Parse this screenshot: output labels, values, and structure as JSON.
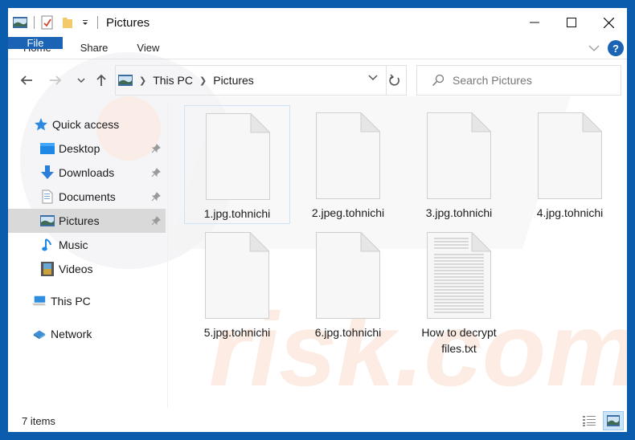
{
  "window": {
    "title": "Pictures",
    "controls": [
      "minimize",
      "maximize",
      "close"
    ]
  },
  "ribbon": {
    "tabs": [
      {
        "label": "File",
        "active": true
      },
      {
        "label": "Home"
      },
      {
        "label": "Share"
      },
      {
        "label": "View"
      }
    ],
    "help_label": "?"
  },
  "navigation": {
    "back": "back-arrow",
    "forward": "forward-arrow",
    "recent": "chevron-down",
    "up": "up-arrow",
    "breadcrumb": [
      "This PC",
      "Pictures"
    ],
    "search_placeholder": "Search Pictures"
  },
  "sidebar": {
    "items": [
      {
        "label": "Quick access",
        "icon": "star-icon",
        "pinned": false
      },
      {
        "label": "Desktop",
        "icon": "desktop-icon",
        "pinned": true
      },
      {
        "label": "Downloads",
        "icon": "download-icon",
        "pinned": true
      },
      {
        "label": "Documents",
        "icon": "documents-icon",
        "pinned": true
      },
      {
        "label": "Pictures",
        "icon": "pictures-icon",
        "pinned": true,
        "selected": true
      },
      {
        "label": "Music",
        "icon": "music-icon",
        "pinned": false
      },
      {
        "label": "Videos",
        "icon": "videos-icon",
        "pinned": false
      },
      {
        "label": "This PC",
        "icon": "computer-icon",
        "pinned": false
      },
      {
        "label": "Network",
        "icon": "network-icon",
        "pinned": false
      }
    ]
  },
  "files": [
    {
      "name": "1.jpg.tohnichi",
      "type": "blank",
      "selected": true
    },
    {
      "name": "2.jpeg.tohnichi",
      "type": "blank"
    },
    {
      "name": "3.jpg.tohnichi",
      "type": "blank"
    },
    {
      "name": "4.jpg.tohnichi",
      "type": "blank"
    },
    {
      "name": "5.jpg.tohnichi",
      "type": "blank"
    },
    {
      "name": "6.jpg.tohnichi",
      "type": "blank"
    },
    {
      "name": "How to decrypt files.txt",
      "type": "text"
    }
  ],
  "status": {
    "item_count": "7 items",
    "views": [
      "details-view",
      "large-icons-view"
    ],
    "active_view": "large-icons-view"
  },
  "colors": {
    "frame": "#0b5cad",
    "accent": "#1a63b5",
    "selection": "#d9d9d9"
  }
}
